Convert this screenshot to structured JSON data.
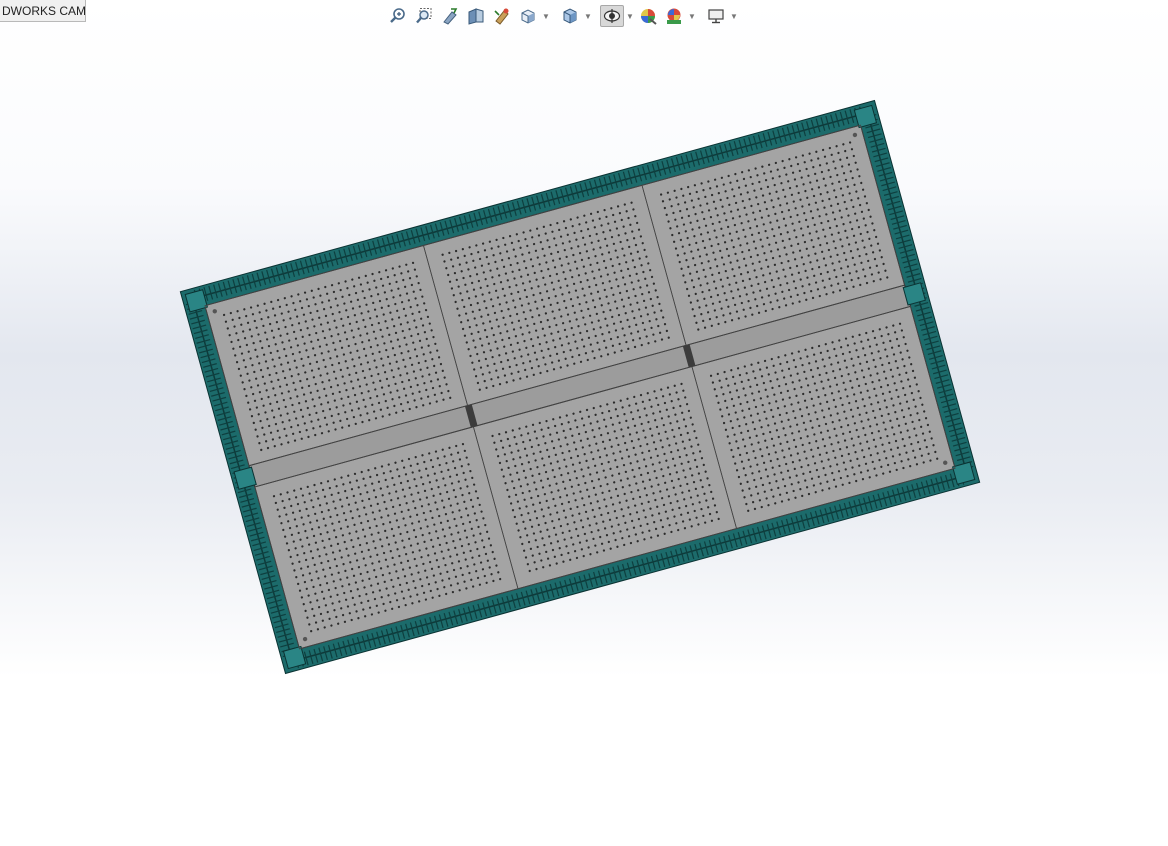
{
  "app": {
    "tab_label": "DWORKS CAM"
  },
  "toolbar": {
    "items": [
      {
        "name": "zoom-to-fit-icon",
        "dropdown": false
      },
      {
        "name": "zoom-to-area-icon",
        "dropdown": false
      },
      {
        "name": "previous-view-icon",
        "dropdown": false
      },
      {
        "name": "section-view-icon",
        "dropdown": false
      },
      {
        "name": "dynamic-annotation-views-icon",
        "dropdown": false
      },
      {
        "name": "view-orientation-icon",
        "dropdown": true
      },
      {
        "name": "display-style-icon",
        "dropdown": true
      },
      {
        "name": "hide-show-items-icon",
        "dropdown": true,
        "active": true
      },
      {
        "name": "edit-appearance-icon",
        "dropdown": false
      },
      {
        "name": "apply-scene-icon",
        "dropdown": true
      },
      {
        "name": "view-settings-icon",
        "dropdown": true
      }
    ]
  },
  "model": {
    "frame_color": "#1c6b6b",
    "frame_inner_color": "#2a8585",
    "plate_color": "#a4a4a4",
    "hole_color": "#2b2b2b",
    "panel_columns": 3,
    "panel_rows": 2
  }
}
